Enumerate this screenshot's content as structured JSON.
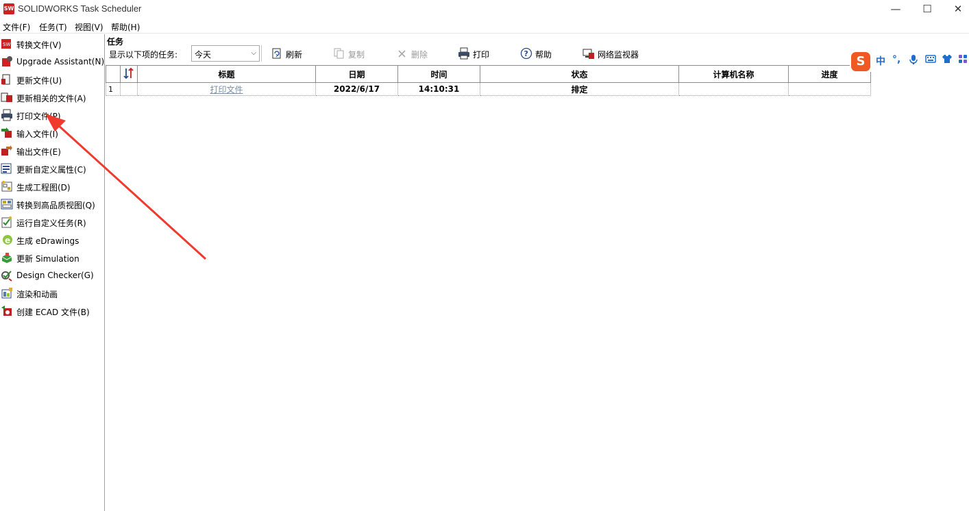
{
  "window": {
    "title": "SOLIDWORKS Task Scheduler",
    "app_icon": "SW",
    "controls": {
      "minimize": "—",
      "maximize": "☐",
      "close": "✕"
    }
  },
  "menubar": [
    "文件(F)",
    "任务(T)",
    "视图(V)",
    "帮助(H)"
  ],
  "sidebar": {
    "items": [
      {
        "label": "转换文件(V)",
        "icon": "convert-files-icon"
      },
      {
        "label": "Upgrade Assistant(N)",
        "icon": "upgrade-assistant-icon"
      },
      {
        "label": "更新文件(U)",
        "icon": "update-files-icon"
      },
      {
        "label": "更新相关的文件(A)",
        "icon": "update-related-files-icon"
      },
      {
        "label": "打印文件(P)",
        "icon": "printer-icon"
      },
      {
        "label": "输入文件(I)",
        "icon": "import-files-icon"
      },
      {
        "label": "输出文件(E)",
        "icon": "export-files-icon"
      },
      {
        "label": "更新自定义属性(C)",
        "icon": "custom-properties-icon"
      },
      {
        "label": "生成工程图(D)",
        "icon": "drawing-icon"
      },
      {
        "label": "转换到高品质视图(Q)",
        "icon": "high-quality-view-icon"
      },
      {
        "label": "运行自定义任务(R)",
        "icon": "custom-task-icon"
      },
      {
        "label": "生成 eDrawings",
        "icon": "edrawings-icon"
      },
      {
        "label": "更新 Simulation",
        "icon": "simulation-icon"
      },
      {
        "label": "Design Checker(G)",
        "icon": "design-checker-icon"
      },
      {
        "label": "渲染和动画",
        "icon": "render-animation-icon"
      },
      {
        "label": "创建 ECAD 文件(B)",
        "icon": "ecad-icon"
      }
    ]
  },
  "tasks_panel": {
    "title": "任务",
    "filter_label": "显示以下项的任务:",
    "filter_value": "今天",
    "toolbar": {
      "refresh": "刷新",
      "copy": "复制",
      "delete": "删除",
      "print": "打印",
      "help": "帮助",
      "network_monitor": "网络监视器"
    },
    "table": {
      "columns": [
        "标题",
        "日期",
        "时间",
        "状态",
        "计算机名称",
        "进度"
      ],
      "rows": [
        {
          "num": "1",
          "title": "打印文件",
          "date": "2022/6/17",
          "time": "14:10:31",
          "status": "排定",
          "computer": "",
          "progress": ""
        }
      ]
    }
  },
  "ime": {
    "logo": "S",
    "mode": "中",
    "punct": "°,",
    "mic": "🎤",
    "keyboard": "⌨",
    "skin": "👕",
    "menu": "▦"
  },
  "colors": {
    "arrow": "#f03a2e",
    "app_icon": "#cc2222",
    "ime_logo": "#f05a22",
    "ime_accent": "#1a6fd1",
    "link": "#7a8ea8"
  }
}
